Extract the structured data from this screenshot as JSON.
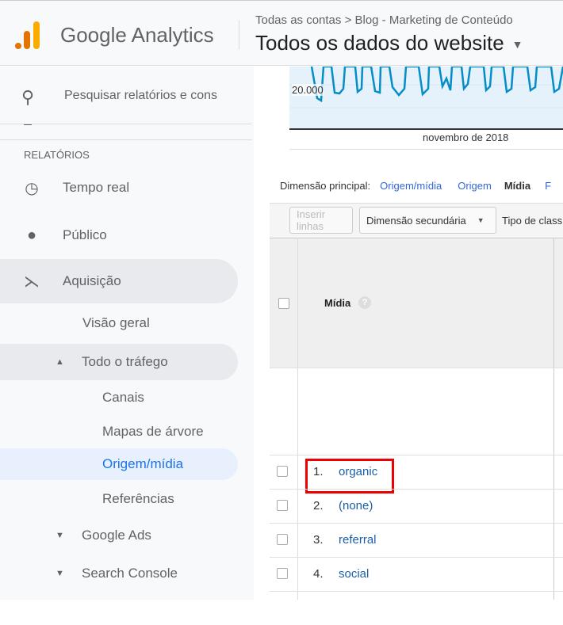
{
  "header": {
    "brand": "Google Analytics",
    "breadcrumb": "Todas as contas > Blog - Marketing de Conteúdo",
    "view": "Todos os dados do website",
    "logo_colors": [
      "#e37400",
      "#f9ab00"
    ]
  },
  "sidebar": {
    "search_placeholder": "Pesquisar relatórios e cons",
    "section": "RELATÓRIOS",
    "items": [
      {
        "label": "Tempo real"
      },
      {
        "label": "Público"
      },
      {
        "label": "Aquisição"
      },
      {
        "label": "Visão geral"
      },
      {
        "label": "Todo o tráfego"
      },
      {
        "label": "Canais"
      },
      {
        "label": "Mapas de árvore"
      },
      {
        "label": "Origem/mídia"
      },
      {
        "label": "Referências"
      },
      {
        "label": "Google Ads"
      },
      {
        "label": "Search Console"
      }
    ]
  },
  "chart": {
    "y_tick": "20.000",
    "x_label": "novembro de 2018",
    "line_color": "#058dc7"
  },
  "dimension": {
    "label": "Dimensão principal:",
    "options": [
      "Origem/mídia",
      "Origem",
      "Mídia",
      "F"
    ],
    "selected": "Mídia"
  },
  "toolbar": {
    "insert_rows": "Inserir linhas",
    "secondary": "Dimensão secundária",
    "sort_type": "Tipo de class"
  },
  "table": {
    "header": "Mídia",
    "rows": [
      {
        "n": "1.",
        "v": "organic"
      },
      {
        "n": "2.",
        "v": "(none)"
      },
      {
        "n": "3.",
        "v": "referral"
      },
      {
        "n": "4.",
        "v": "social"
      }
    ]
  }
}
